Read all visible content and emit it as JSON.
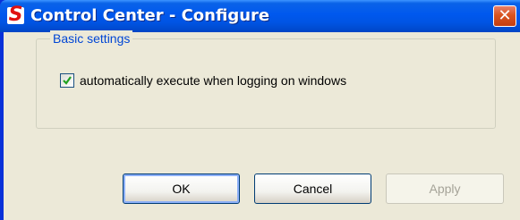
{
  "window": {
    "title": "Control Center - Configure",
    "logo_letter": "S",
    "close_glyph": "✕"
  },
  "group": {
    "title": "Basic settings",
    "checkbox_label": "automatically execute when logging on windows",
    "checkbox_checked": true
  },
  "buttons": {
    "ok": "OK",
    "cancel": "Cancel",
    "apply": "Apply"
  },
  "icons": {
    "logo": "app-logo-icon",
    "close": "close-icon",
    "check": "checkmark-icon"
  },
  "colors": {
    "titlebar": "#0054e3",
    "close": "#d9541f",
    "dialog_bg": "#ece9d8",
    "group_title": "#0046d5",
    "checkmark": "#21a121"
  }
}
